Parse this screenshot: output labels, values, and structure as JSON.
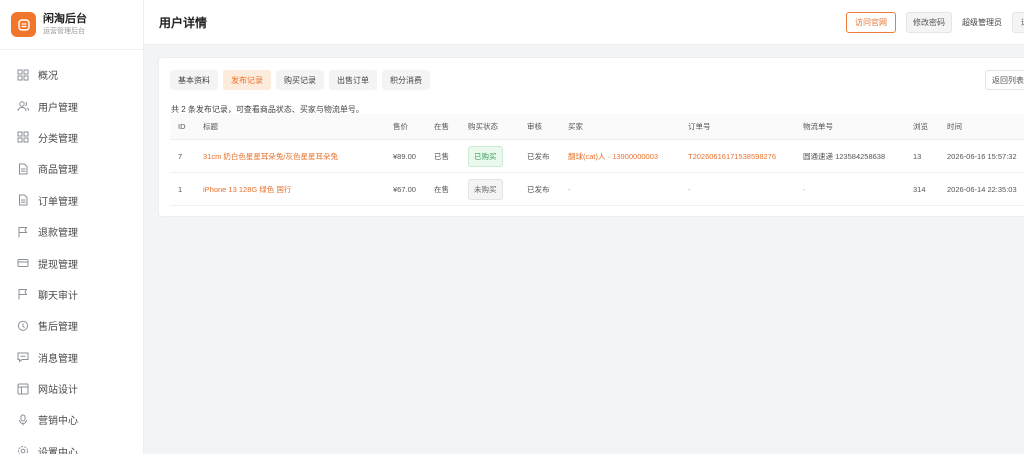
{
  "brand": {
    "title": "闲淘后台",
    "subtitle": "运营管理后台"
  },
  "sidebar": {
    "items": [
      {
        "label": "概况",
        "icon": "grid-icon"
      },
      {
        "label": "用户管理",
        "icon": "users-icon"
      },
      {
        "label": "分类管理",
        "icon": "grid-icon"
      },
      {
        "label": "商品管理",
        "icon": "document-icon"
      },
      {
        "label": "订单管理",
        "icon": "document-icon"
      },
      {
        "label": "退款管理",
        "icon": "flag-icon"
      },
      {
        "label": "提现管理",
        "icon": "card-icon"
      },
      {
        "label": "聊天审计",
        "icon": "flag-icon"
      },
      {
        "label": "售后管理",
        "icon": "chat-icon"
      },
      {
        "label": "消息管理",
        "icon": "message-icon"
      },
      {
        "label": "网站设计",
        "icon": "layout-icon"
      },
      {
        "label": "营销中心",
        "icon": "mic-icon"
      },
      {
        "label": "设置中心",
        "icon": "gear-icon"
      }
    ]
  },
  "header": {
    "title": "用户详情",
    "visit_label": "访问官网",
    "password_label": "修改密码",
    "admin_name": "超级管理员",
    "logout_label": "退出"
  },
  "tabs": [
    {
      "label": "基本资料",
      "active": false
    },
    {
      "label": "发布记录",
      "active": true
    },
    {
      "label": "购买记录",
      "active": false
    },
    {
      "label": "出售订单",
      "active": false
    },
    {
      "label": "积分消费",
      "active": false
    }
  ],
  "back_label": "返回列表",
  "summary": "共 2 条发布记录，可查看商品状态、买家与物流单号。",
  "table": {
    "headers": [
      "ID",
      "标题",
      "售价",
      "在售",
      "购买状态",
      "审核",
      "买家",
      "订单号",
      "物流单号",
      "浏览",
      "时间"
    ],
    "rows": [
      {
        "id": "7",
        "title": "31cm 奶白色星星耳朵兔/灰色星星耳朵兔",
        "price": "¥89.00",
        "stock": "已售",
        "status": "已购买",
        "status_type": "green",
        "audit": "已发布",
        "buyer": "翻球(cat)人 · 13900000003",
        "order_no": "T20260616171538598276",
        "shipping": "圆通速递 123584258638",
        "views": "13",
        "time": "2026-06-16 15:57:32"
      },
      {
        "id": "1",
        "title": "iPhone 13 128G 绿色 国行",
        "price": "¥67.00",
        "stock": "在售",
        "status": "未购买",
        "status_type": "gray",
        "audit": "已发布",
        "buyer": "-",
        "order_no": "-",
        "shipping": "-",
        "views": "314",
        "time": "2026-06-14 22:35:03"
      }
    ]
  },
  "colors": {
    "accent": "#e8712c",
    "success": "#3aa05a"
  }
}
